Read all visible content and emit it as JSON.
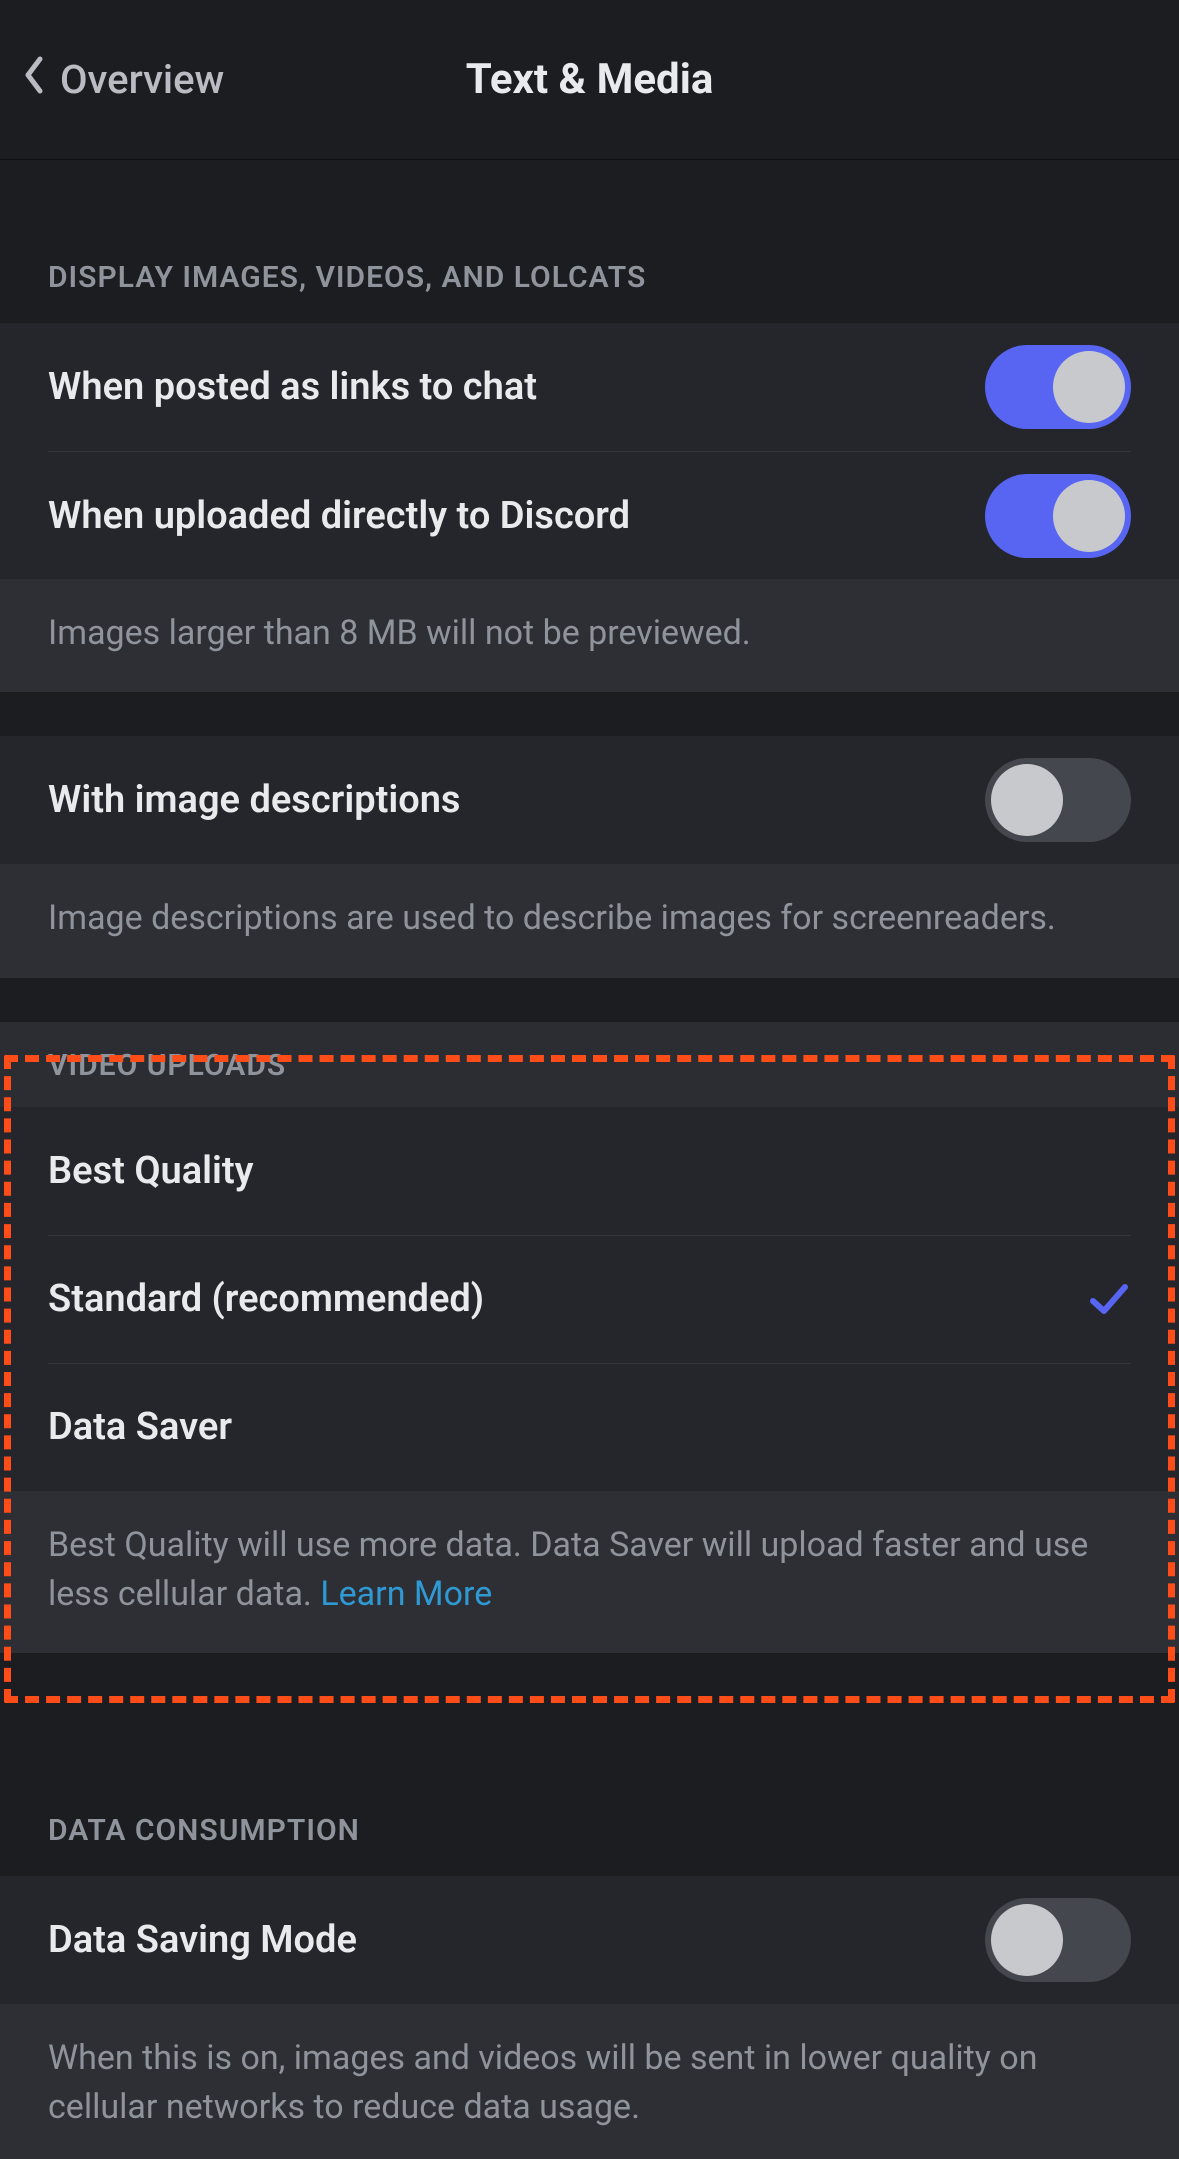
{
  "header": {
    "back_label": "Overview",
    "title": "Text & Media"
  },
  "sections": {
    "display_media": {
      "header": "DISPLAY IMAGES, VIDEOS, AND LOLCATS",
      "rows": {
        "links": {
          "label": "When posted as links to chat",
          "on": true
        },
        "uploaded": {
          "label": "When uploaded directly to Discord",
          "on": true
        }
      },
      "footer": "Images larger than 8 MB will not be previewed."
    },
    "image_descriptions": {
      "row": {
        "label": "With image descriptions",
        "on": false
      },
      "footer": "Image descriptions are used to describe images for screenreaders."
    },
    "video_uploads": {
      "header": "VIDEO UPLOADS",
      "options": [
        {
          "label": "Best Quality",
          "selected": false
        },
        {
          "label": "Standard (recommended)",
          "selected": true
        },
        {
          "label": "Data Saver",
          "selected": false
        }
      ],
      "footer_text": "Best Quality will use more data. Data Saver will upload faster and use less cellular data. ",
      "footer_link": "Learn More"
    },
    "data_consumption": {
      "header": "DATA CONSUMPTION",
      "row": {
        "label": "Data Saving Mode",
        "on": false
      },
      "footer": "When this is on, images and videos will be sent in lower quality on cellular networks to reduce data usage."
    }
  }
}
